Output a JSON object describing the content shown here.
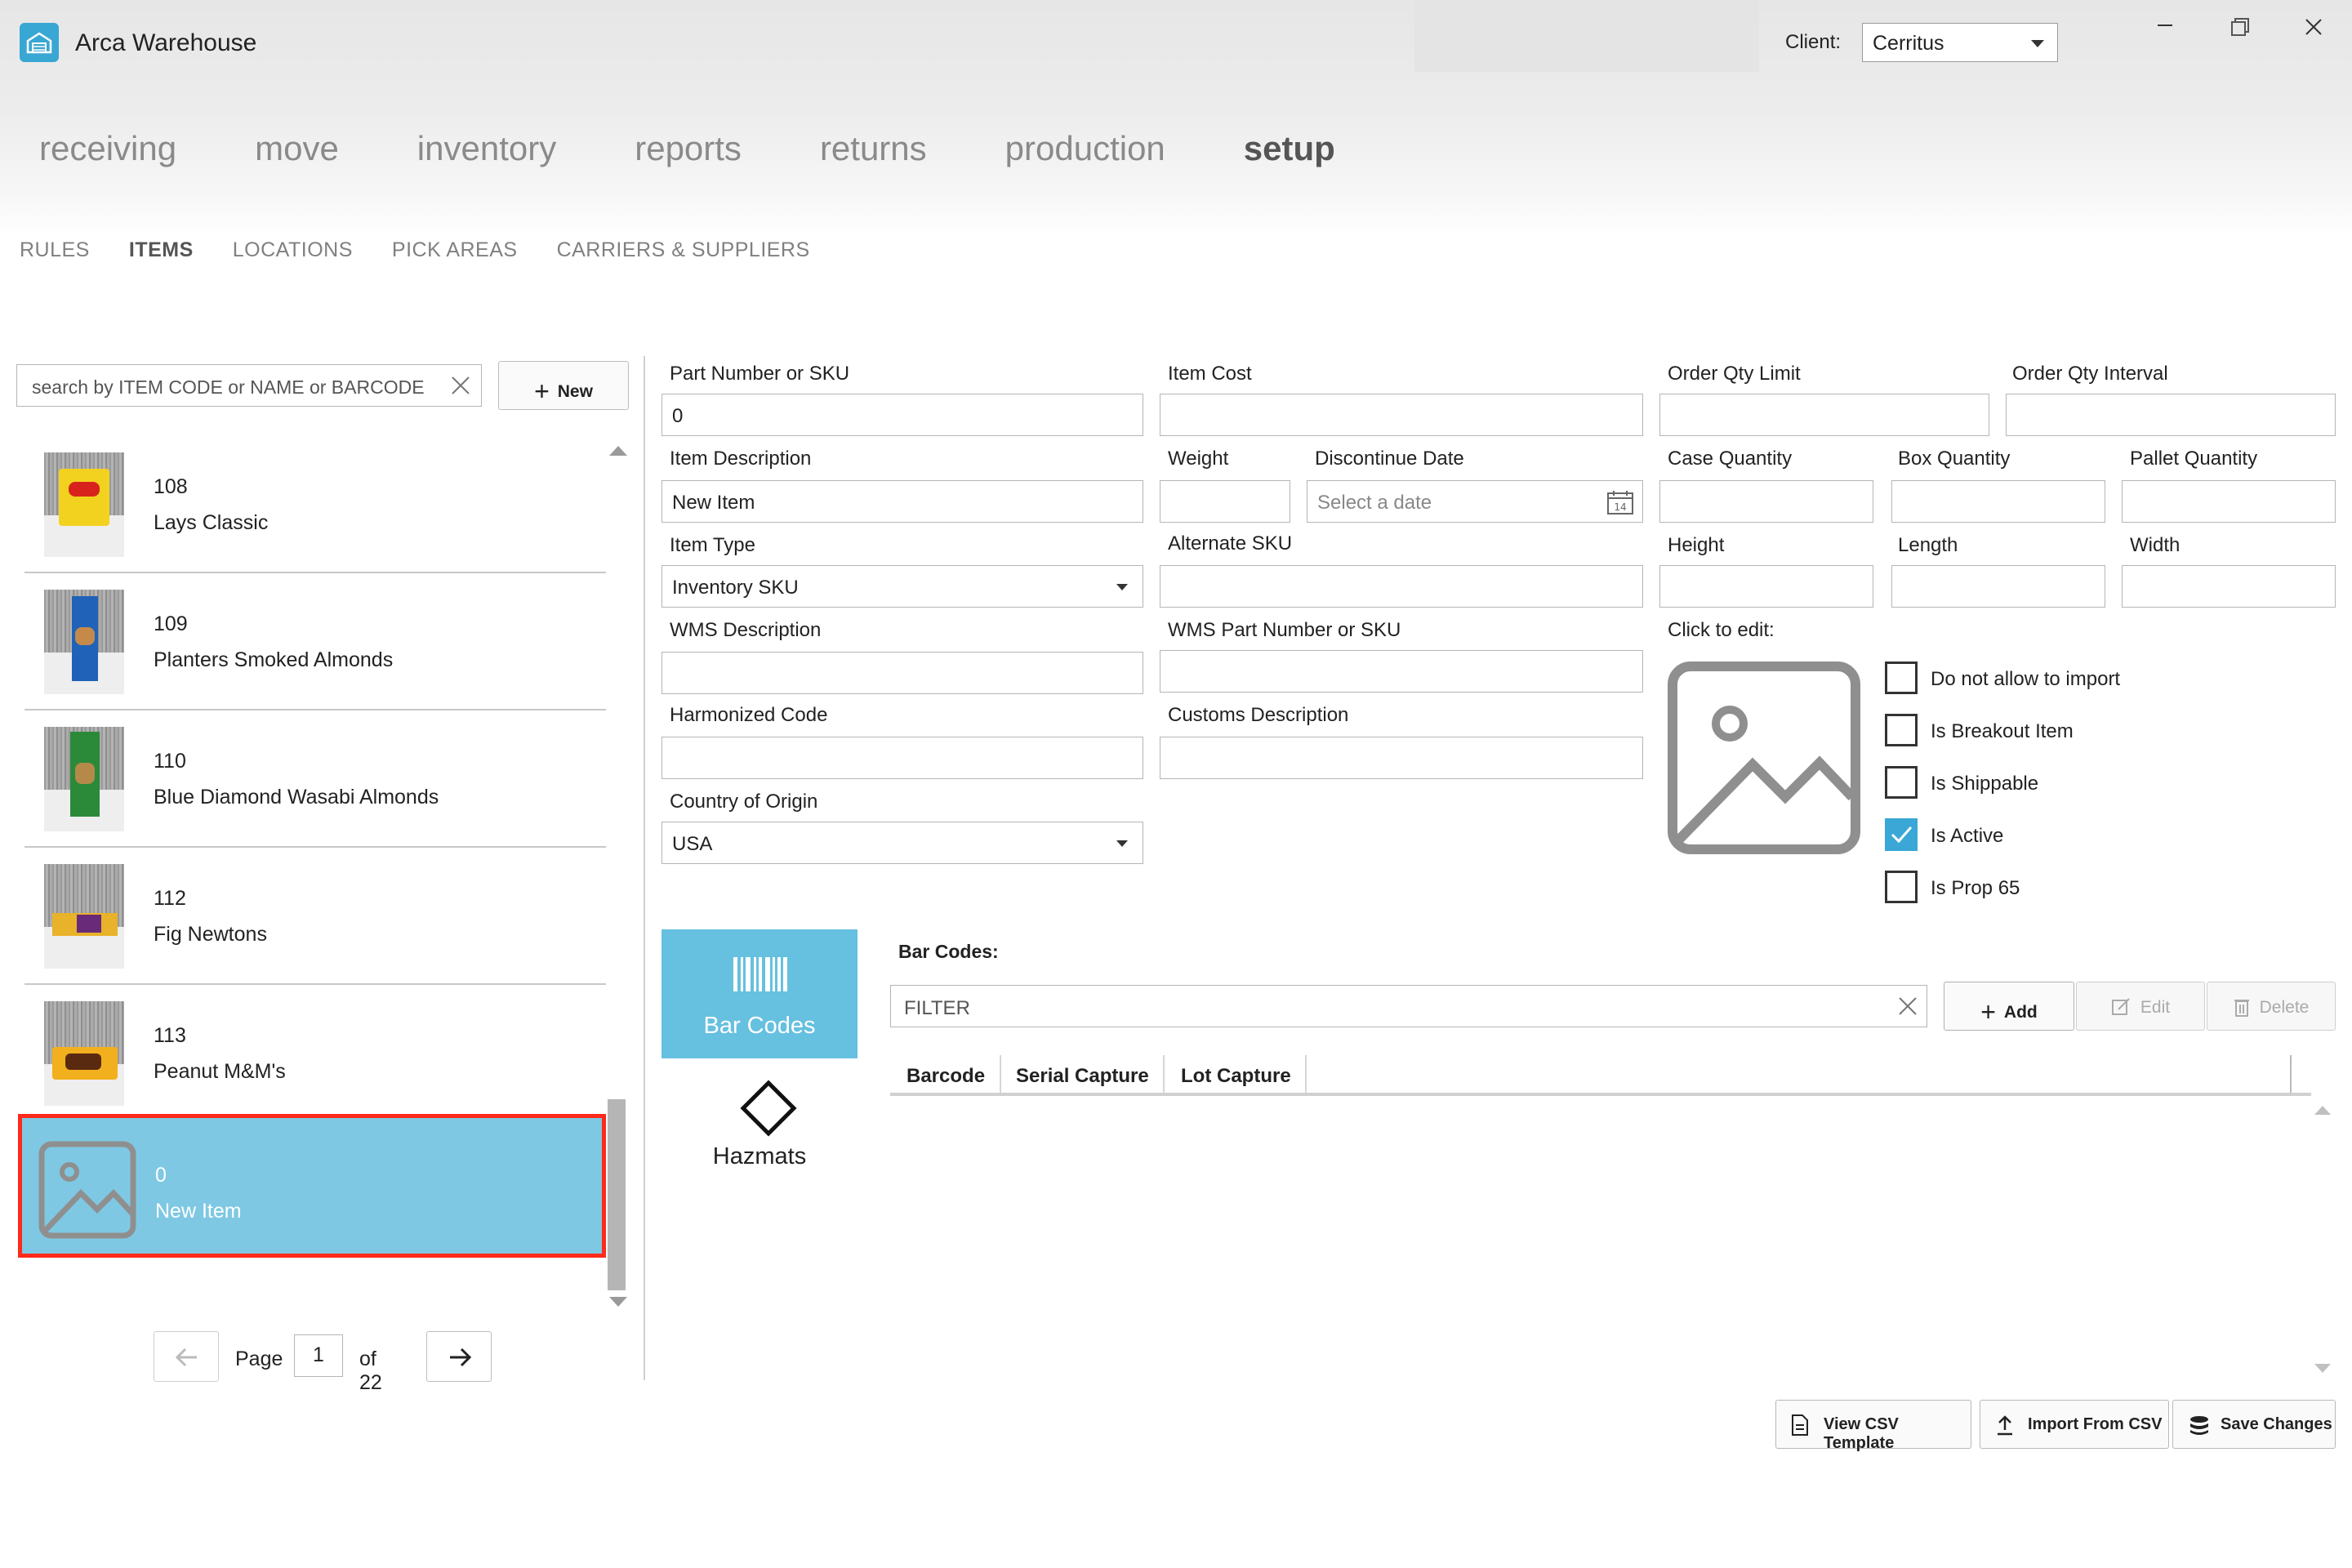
{
  "app": {
    "title": "Arca Warehouse"
  },
  "client": {
    "label": "Client:",
    "value": "Cerritus"
  },
  "main_nav": [
    "receiving",
    "move",
    "inventory",
    "reports",
    "returns",
    "production",
    "setup"
  ],
  "main_nav_active": "setup",
  "sub_nav": [
    "RULES",
    "ITEMS",
    "LOCATIONS",
    "PICK AREAS",
    "CARRIERS & SUPPLIERS"
  ],
  "sub_nav_active": "ITEMS",
  "search": {
    "placeholder": "search by ITEM CODE or NAME or BARCODE"
  },
  "new_button": "New",
  "items": [
    {
      "code": "108",
      "name": "Lays Classic",
      "pkg_color": "#f2d21e"
    },
    {
      "code": "109",
      "name": "Planters Smoked Almonds",
      "pkg_color": "#1f62b8"
    },
    {
      "code": "110",
      "name": "Blue Diamond Wasabi Almonds",
      "pkg_color": "#2a8a3a"
    },
    {
      "code": "112",
      "name": "Fig Newtons",
      "pkg_color": "#e8b22a"
    },
    {
      "code": "113",
      "name": "Peanut M&M's",
      "pkg_color": "#f2b01e"
    }
  ],
  "selected_item": {
    "code": "0",
    "name": "New Item"
  },
  "pager": {
    "page_label": "Page",
    "page": "1",
    "of_label": "of 22"
  },
  "form": {
    "part_number_label": "Part Number or SKU",
    "part_number": "0",
    "item_cost_label": "Item Cost",
    "item_cost": "",
    "order_qty_limit_label": "Order Qty Limit",
    "order_qty_limit": "",
    "order_qty_interval_label": "Order Qty Interval",
    "order_qty_interval": "",
    "item_description_label": "Item Description",
    "item_description": "New Item",
    "weight_label": "Weight",
    "weight": "",
    "discontinue_date_label": "Discontinue Date",
    "discontinue_date_placeholder": "Select a date",
    "case_quantity_label": "Case Quantity",
    "box_quantity_label": "Box Quantity",
    "pallet_quantity_label": "Pallet Quantity",
    "item_type_label": "Item Type",
    "item_type": "Inventory SKU",
    "alternate_sku_label": "Alternate SKU",
    "height_label": "Height",
    "length_label": "Length",
    "width_label": "Width",
    "wms_description_label": "WMS Description",
    "wms_part_number_label": "WMS Part Number or SKU",
    "click_to_edit_label": "Click to edit:",
    "harmonized_code_label": "Harmonized Code",
    "customs_description_label": "Customs Description",
    "country_of_origin_label": "Country of Origin",
    "country_of_origin": "USA"
  },
  "checkboxes": [
    {
      "label": "Do not allow to import",
      "checked": false
    },
    {
      "label": "Is Breakout Item",
      "checked": false
    },
    {
      "label": "Is Shippable",
      "checked": false
    },
    {
      "label": "Is Active",
      "checked": true
    },
    {
      "label": "Is Prop 65",
      "checked": false
    }
  ],
  "tabs": {
    "barcodes": "Bar Codes",
    "hazmats": "Hazmats"
  },
  "barcodes": {
    "title": "Bar Codes:",
    "filter_placeholder": "FILTER",
    "add": "Add",
    "edit": "Edit",
    "delete": "Delete",
    "columns": [
      "Barcode",
      "Serial Capture",
      "Lot Capture"
    ]
  },
  "bottom_buttons": {
    "view_csv": "View CSV Template",
    "import_csv": "Import From CSV",
    "save": "Save Changes"
  },
  "colors": {
    "accent": "#66c0e0",
    "selected": "#7ec8e3",
    "highlight_border": "#ff2a1a",
    "checked": "#3aa7d6"
  }
}
